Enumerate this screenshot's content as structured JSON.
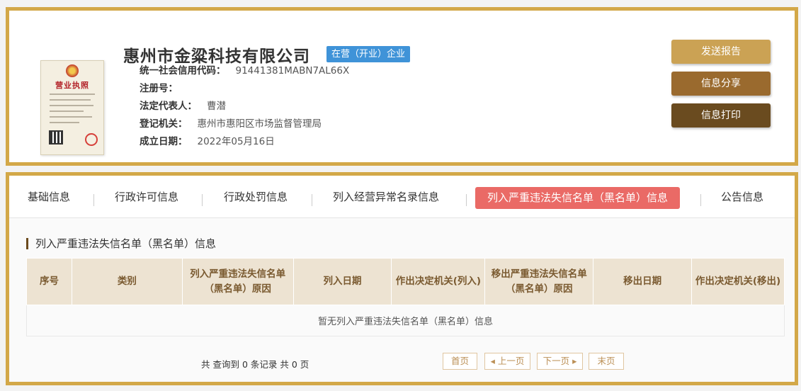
{
  "license": {
    "title": "营业执照"
  },
  "company": {
    "name": "惠州市金粱科技有限公司",
    "status": "在营（开业）企业"
  },
  "info": [
    {
      "label": "统一社会信用代码：",
      "value": "91441381MABN7AL66X"
    },
    {
      "label": "注册号：",
      "value": ""
    },
    {
      "label": "法定代表人：",
      "value": "曹潜"
    },
    {
      "label": "登记机关：",
      "value": "惠州市惠阳区市场监督管理局"
    },
    {
      "label": "成立日期：",
      "value": "2022年05月16日"
    }
  ],
  "actions": {
    "send_report": "发送报告",
    "share": "信息分享",
    "print": "信息打印"
  },
  "tabs": [
    {
      "label": "基础信息"
    },
    {
      "label": "行政许可信息"
    },
    {
      "label": "行政处罚信息"
    },
    {
      "label": "列入经营异常名录信息"
    },
    {
      "label": "列入严重违法失信名单（黑名单）信息"
    },
    {
      "label": "公告信息"
    }
  ],
  "section": {
    "title": "列入严重违法失信名单（黑名单）信息"
  },
  "table": {
    "headers": [
      "序号",
      "类别",
      "列入严重违法失信名单（黑名单）原因",
      "列入日期",
      "作出决定机关(列入)",
      "移出严重违法失信名单（黑名单）原因",
      "移出日期",
      "作出决定机关(移出)"
    ],
    "empty": "暂无列入严重违法失信名单（黑名单）信息"
  },
  "pagination": {
    "summary": "共 查询到 0 条记录 共 0 页",
    "first": "首页",
    "prev": "上一页",
    "next": "下一页",
    "last": "末页",
    "prev_glyph": "◂",
    "next_glyph": "▸"
  }
}
